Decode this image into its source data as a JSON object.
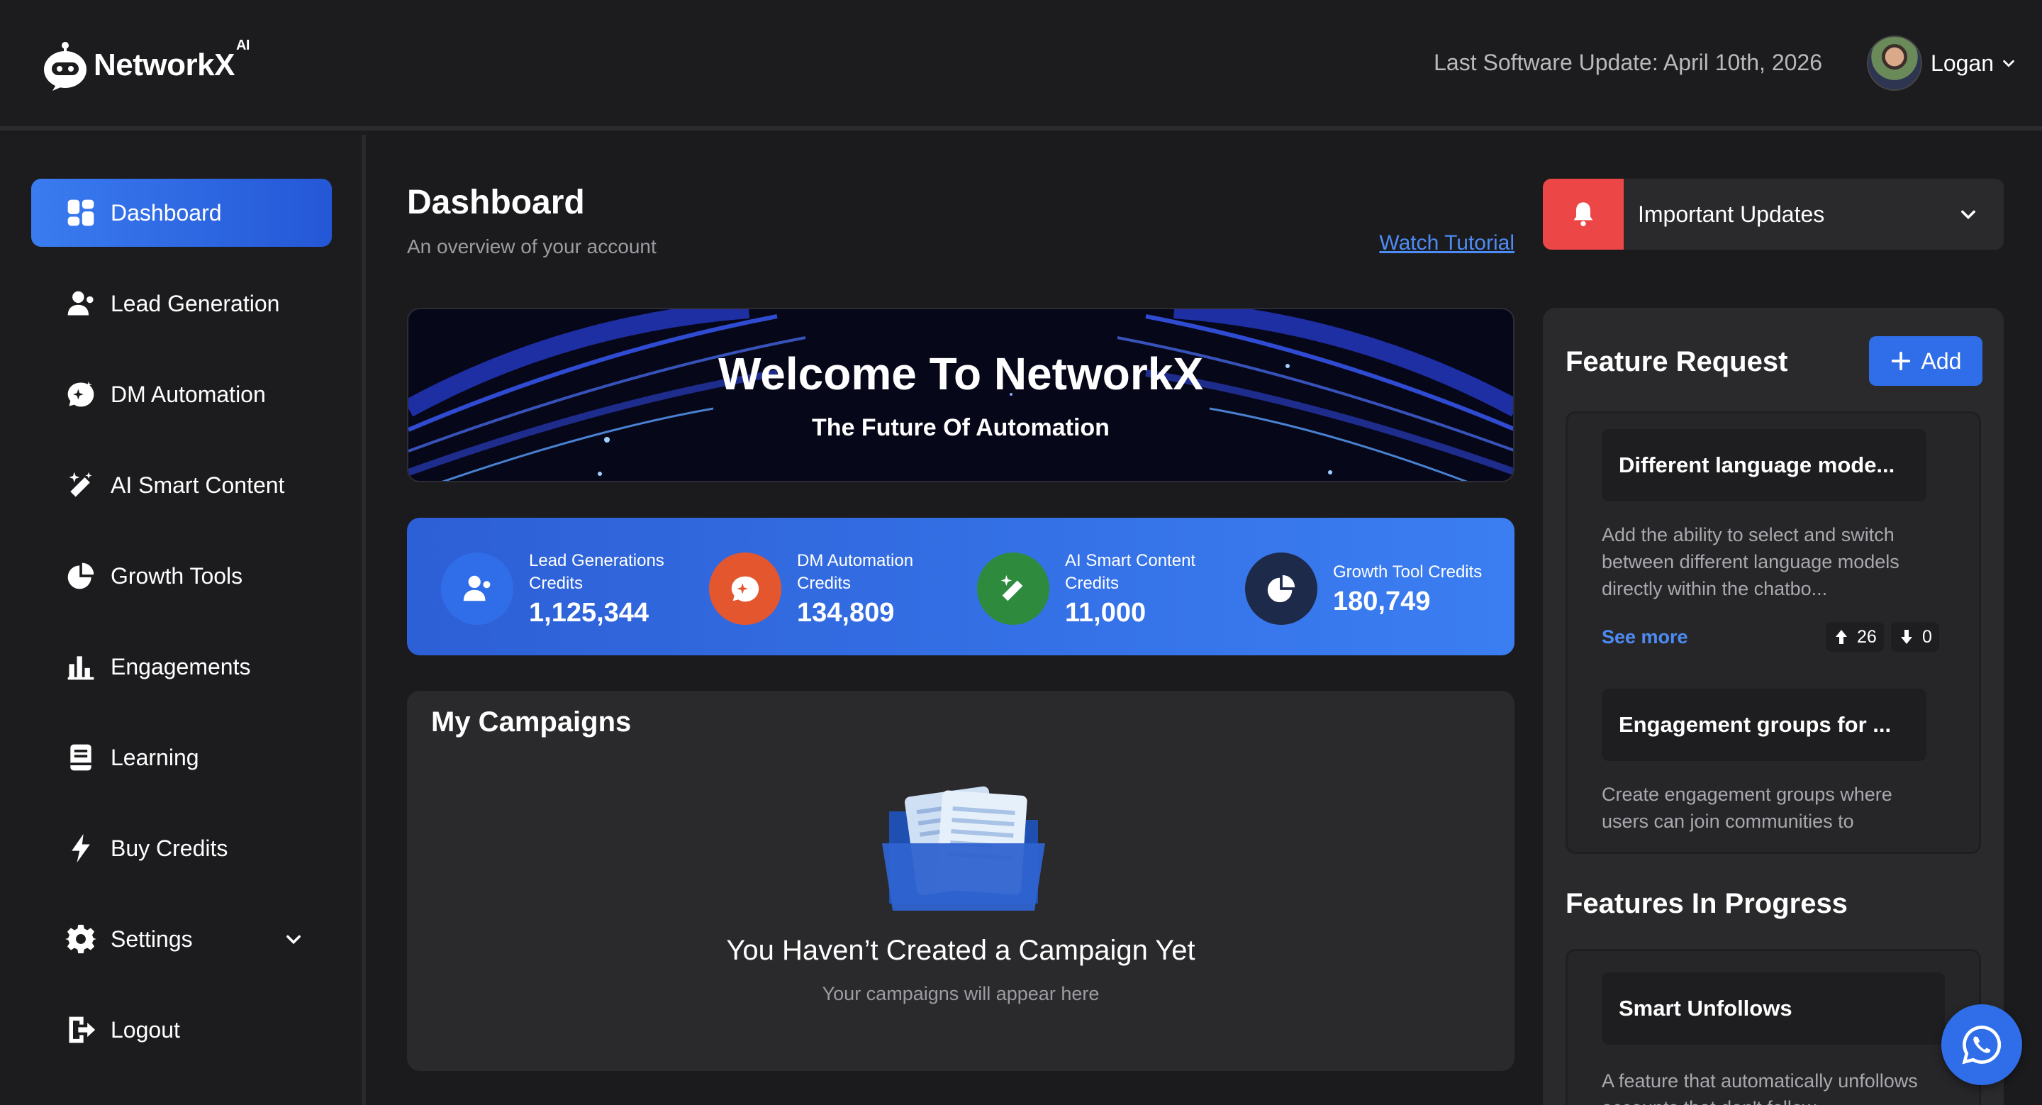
{
  "brand": {
    "name": "NetworkX",
    "superscript": "AI"
  },
  "header": {
    "last_update": "Last Software Update: April 10th, 2026",
    "user_name": "Logan"
  },
  "sidebar": {
    "items": [
      {
        "label": "Dashboard",
        "icon": "grid-icon",
        "active": true
      },
      {
        "label": "Lead Generation",
        "icon": "users-icon"
      },
      {
        "label": "DM Automation",
        "icon": "chat-sparkle-icon"
      },
      {
        "label": "AI Smart Content",
        "icon": "magic-wand-icon"
      },
      {
        "label": "Growth Tools",
        "icon": "pie-chart-icon"
      },
      {
        "label": "Engagements",
        "icon": "bar-chart-icon"
      },
      {
        "label": "Learning",
        "icon": "book-icon"
      },
      {
        "label": "Buy Credits",
        "icon": "bolt-icon"
      },
      {
        "label": "Settings",
        "icon": "gear-icon"
      },
      {
        "label": "Logout",
        "icon": "logout-icon"
      }
    ]
  },
  "main": {
    "title": "Dashboard",
    "subtitle": "An overview of your account",
    "watch_tutorial": "Watch Tutorial",
    "banner": {
      "title": "Welcome To NetworkX",
      "subtitle": "The Future Of Automation"
    },
    "credits": [
      {
        "label": "Lead Generations Credits",
        "value": "1,125,344",
        "color": "#2f6ee8",
        "icon": "users-icon"
      },
      {
        "label": "DM Automation Credits",
        "value": "134,809",
        "color": "#e4572e",
        "icon": "chat-sparkle-icon"
      },
      {
        "label": "AI Smart Content Credits",
        "value": "11,000",
        "color": "#2e8b3e",
        "icon": "magic-wand-icon"
      },
      {
        "label": "Growth Tool Credits",
        "value": "180,749",
        "color": "#1e2a4a",
        "icon": "pie-chart-icon"
      }
    ],
    "campaigns": {
      "title": "My Campaigns",
      "empty_title": "You Haven’t Created a Campaign Yet",
      "empty_sub": "Your campaigns will appear here"
    }
  },
  "right": {
    "updates_label": "Important Updates",
    "feature_request": {
      "title": "Feature Request",
      "add_label": "Add",
      "items": [
        {
          "title": "Different language mode...",
          "desc": "Add the ability to select and switch between different language models directly within the chatbo...",
          "see_more": "See more",
          "upvotes": "26",
          "downvotes": "0"
        },
        {
          "title": "Engagement groups for ...",
          "desc": "Create engagement groups where users can join communities to"
        }
      ]
    },
    "in_progress": {
      "title": "Features In Progress",
      "items": [
        {
          "title": "Smart Unfollows",
          "desc": "A feature that automatically unfollows accounts that don't follow"
        }
      ]
    }
  },
  "colors": {
    "accent": "#2f6ee8",
    "alert": "#ec4746",
    "background": "#1b1b1d",
    "panel": "#2a2a2c"
  }
}
